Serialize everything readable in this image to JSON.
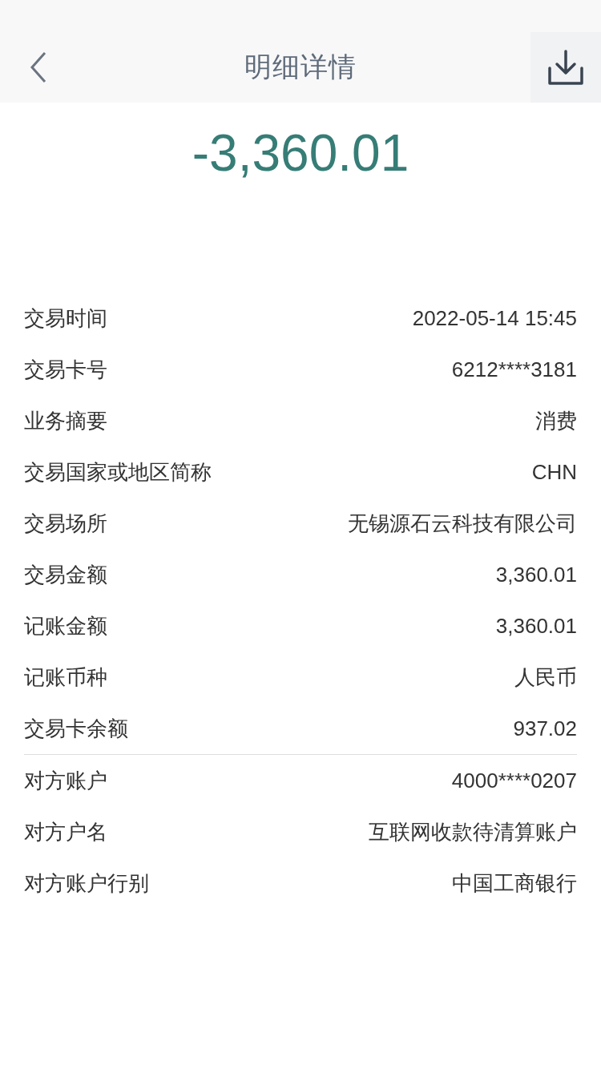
{
  "header": {
    "title": "明细详情"
  },
  "amount": "-3,360.01",
  "groups": [
    [
      {
        "label": "交易时间",
        "value": "2022-05-14 15:45"
      },
      {
        "label": "交易卡号",
        "value": "6212****3181"
      },
      {
        "label": "业务摘要",
        "value": "消费"
      },
      {
        "label": "交易国家或地区简称",
        "value": "CHN"
      },
      {
        "label": "交易场所",
        "value": "无锡源石云科技有限公司"
      },
      {
        "label": "交易金额",
        "value": "3,360.01"
      },
      {
        "label": "记账金额",
        "value": "3,360.01"
      },
      {
        "label": "记账币种",
        "value": "人民币"
      },
      {
        "label": "交易卡余额",
        "value": "937.02"
      }
    ],
    [
      {
        "label": "对方账户",
        "value": "4000****0207"
      },
      {
        "label": "对方户名",
        "value": "互联网收款待清算账户"
      },
      {
        "label": "对方账户行别",
        "value": "中国工商银行"
      }
    ]
  ]
}
